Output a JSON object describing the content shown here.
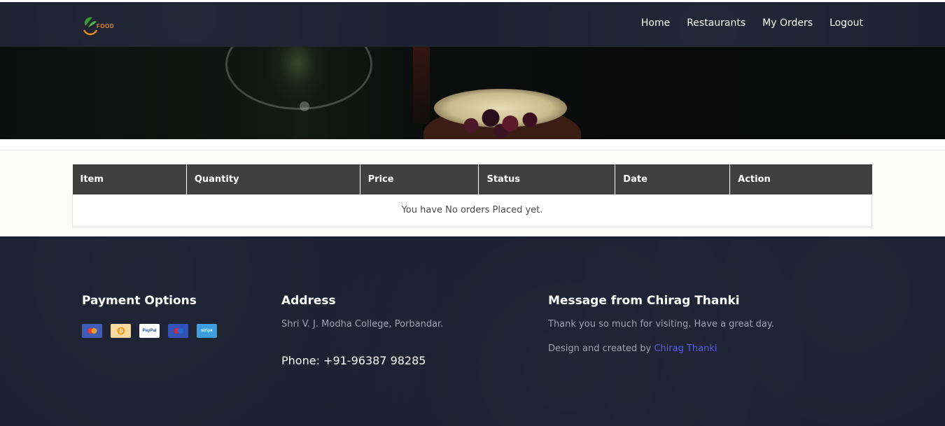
{
  "navbar": {
    "logo_text": "FOOD",
    "links": [
      "Home",
      "Restaurants",
      "My Orders",
      "Logout"
    ]
  },
  "orders_table": {
    "columns": [
      "Item",
      "Quantity",
      "Price",
      "Status",
      "Date",
      "Action"
    ],
    "empty_message": "You have No orders Placed yet."
  },
  "footer": {
    "payment": {
      "heading": "Payment Options",
      "cards": [
        "mastercard-icon",
        "bitcoin-icon",
        "PayPal",
        "maestro-icon",
        "stripe"
      ]
    },
    "address": {
      "heading": "Address",
      "text": "Shri V. J. Modha College, Porbandar.",
      "phone": "Phone: +91-96387 98285"
    },
    "message": {
      "heading": "Message from Chirag Thanki",
      "text": "Thank you so much for visiting. Have a great day.",
      "credit_prefix": "Design and created by ",
      "credit_link": "Chirag Thanki"
    }
  },
  "colors": {
    "navbar_bg": "#1b2030",
    "table_header_bg": "#404040",
    "link_accent": "#5b5bf0",
    "logo_orange": "#e88a1a"
  }
}
